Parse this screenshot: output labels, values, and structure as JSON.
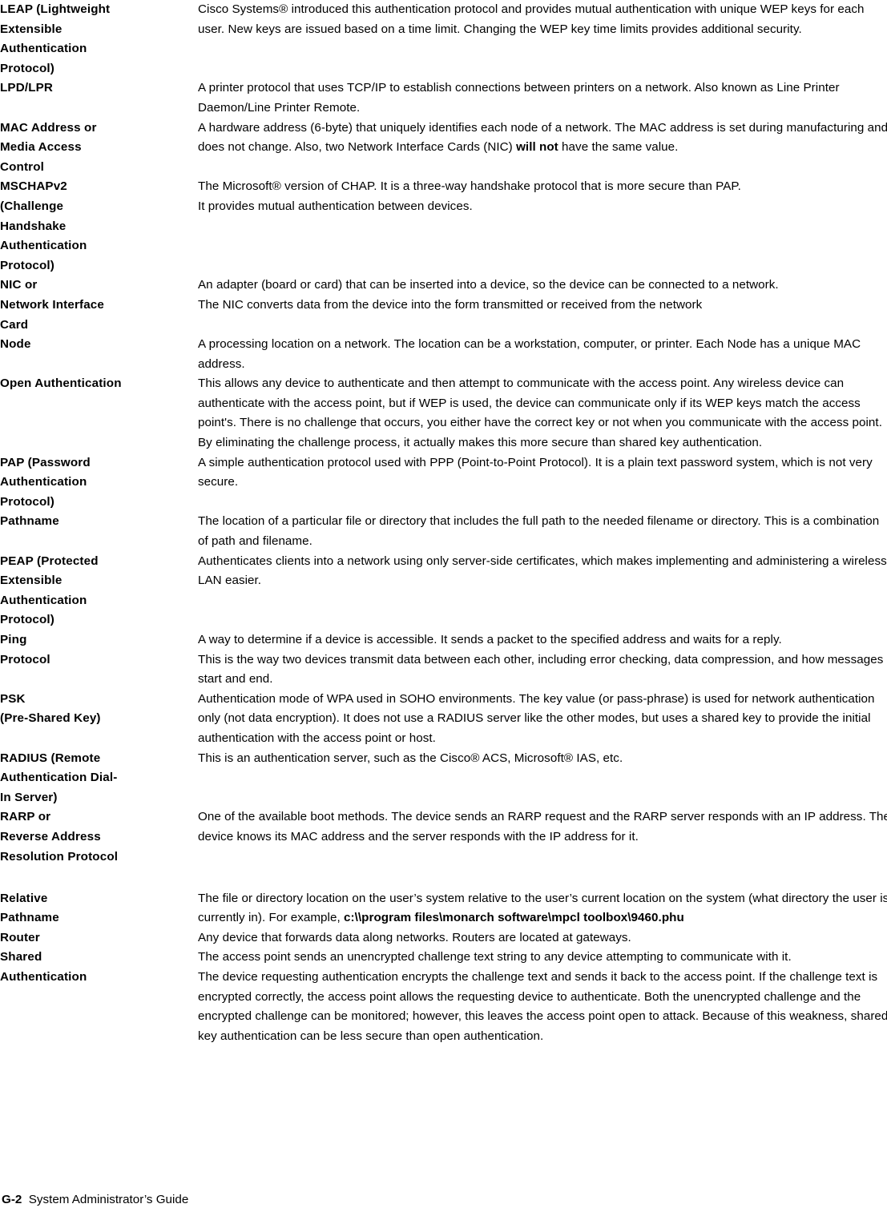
{
  "document": {
    "footer": {
      "page_number": "G-2",
      "title": "System Administrator’s Guide"
    }
  },
  "glossary": {
    "entries": [
      {
        "term": "LEAP (Lightweight\nExtensible\nAuthentication\nProtocol)",
        "definition": "Cisco Systems® introduced this authentication protocol and provides mutual authentication with unique WEP keys for each user.  New keys are issued based on a time limit.  Changing the WEP key time limits provides additional security.",
        "trailing_space": 14
      },
      {
        "term": "LPD/LPR",
        "definition": "A printer protocol that uses TCP/IP to establish connections between printers on a network.  Also known as Line Printer Daemon/Line Printer Remote.",
        "trailing_space": 0
      },
      {
        "term": "MAC Address or\nMedia Access\nControl",
        "definition_pre": "A hardware address (6-byte) that uniquely identifies each node of a network.  The MAC address is set during manufacturing and does not change.  Also, two Network Interface Cards (NIC) ",
        "definition_bold": "will not",
        "definition_post": " have the same value.",
        "trailing_space": 0
      },
      {
        "term": "MSCHAPv2\n(Challenge\nHandshake\nAuthentication\nProtocol)",
        "definition": "The Microsoft® version of CHAP.  It is a three-way handshake protocol that is more secure than PAP.",
        "definition_2": "It provides mutual authentication between devices.",
        "trailing_space": 14
      },
      {
        "term": "NIC or\nNetwork Interface\nCard",
        "definition": "An adapter (board or card) that can be inserted into a device, so the device can be connected to a network.",
        "definition_2": "The NIC converts data from the device into the form transmitted or received from the network",
        "trailing_space": 0
      },
      {
        "term": "Node",
        "definition": "A processing location on a network.  The location can be a workstation, computer, or printer.  Each Node has a unique MAC address.",
        "trailing_space": 0
      },
      {
        "term": "Open Authentication",
        "definition": "This allows any device to authenticate and then attempt to communicate with the access point.  Any wireless device can authenticate with the access point, but if WEP is used, the device can communicate only if its WEP keys match the access point's.  There is no challenge that occurs, you either have the correct key or not when you communicate with the access point.  By eliminating the challenge process, it actually makes this more secure than shared key authentication.",
        "trailing_space": 0
      },
      {
        "term": "PAP (Password\nAuthentication\nProtocol)",
        "definition": "A simple authentication protocol used with PPP (Point-to-Point Protocol).  It is a plain text password system, which is not very secure.",
        "trailing_space": 4
      },
      {
        "term": "Pathname",
        "definition": "The location of a particular file or directory that includes the full path to the needed filename or directory.  This is a combination of path and filename.",
        "trailing_space": 0
      },
      {
        "term": "PEAP (Protected\nExtensible\nAuthentication\nProtocol)",
        "definition": "Authenticates clients into a network using only server-side certificates, which makes implementing and administering a wireless LAN easier.",
        "trailing_space": 14
      },
      {
        "term": "Ping",
        "definition": "A way to determine if a device is accessible.  It sends a packet to the specified address and waits for a reply.",
        "trailing_space": 0
      },
      {
        "term": "Protocol",
        "definition": "This is the way two devices transmit data between each other, including error checking, data compression, and how messages start and end.",
        "trailing_space": 0
      },
      {
        "term": "PSK\n(Pre-Shared Key)",
        "definition": "Authentication mode of WPA used in SOHO environments.  The key value (or pass-phrase) is used for network authentication only (not data encryption). It does not use a RADIUS server like the other modes, but uses a shared key to provide the initial authentication with the access point or host.",
        "trailing_space": 0
      },
      {
        "term": "RADIUS (Remote\nAuthentication Dial-\nIn Server)",
        "definition": "This is an authentication server, such as the Cisco® ACS, Microsoft® IAS, etc.",
        "trailing_space": 10
      },
      {
        "term": "RARP or\nReverse Address\nResolution Protocol",
        "definition": "One of the available boot methods.  The device sends an RARP request and the RARP server responds with an IP address.  The device knows its MAC address and the server responds with the IP address for it.",
        "trailing_space": 48
      },
      {
        "term": "Relative\nPathname",
        "definition_pre": "The file or directory location on the user’s system relative to the user’s current location on the system (what directory the user is currently in).  For example, ",
        "definition_bold": "c:\\\\program files\\monarch software\\mpcl toolbox\\9460.phu",
        "definition_post": "",
        "trailing_space": 0
      },
      {
        "term": "Router",
        "definition": "Any device that forwards data along networks.  Routers are located at gateways.",
        "trailing_space": 0
      },
      {
        "term": "Shared\nAuthentication",
        "definition": "The access point sends an unencrypted challenge text string to any device attempting to communicate with it.",
        "definition_2": "The device requesting authentication encrypts the challenge text and sends it back to the access point.  If the challenge text is encrypted correctly, the access point allows the requesting device to authenticate.  Both the unencrypted challenge and the encrypted challenge can be monitored; however, this leaves the access point open to attack.  Because of this weakness, shared key authentication can be less secure than open authentication.",
        "trailing_space": 0
      }
    ]
  }
}
